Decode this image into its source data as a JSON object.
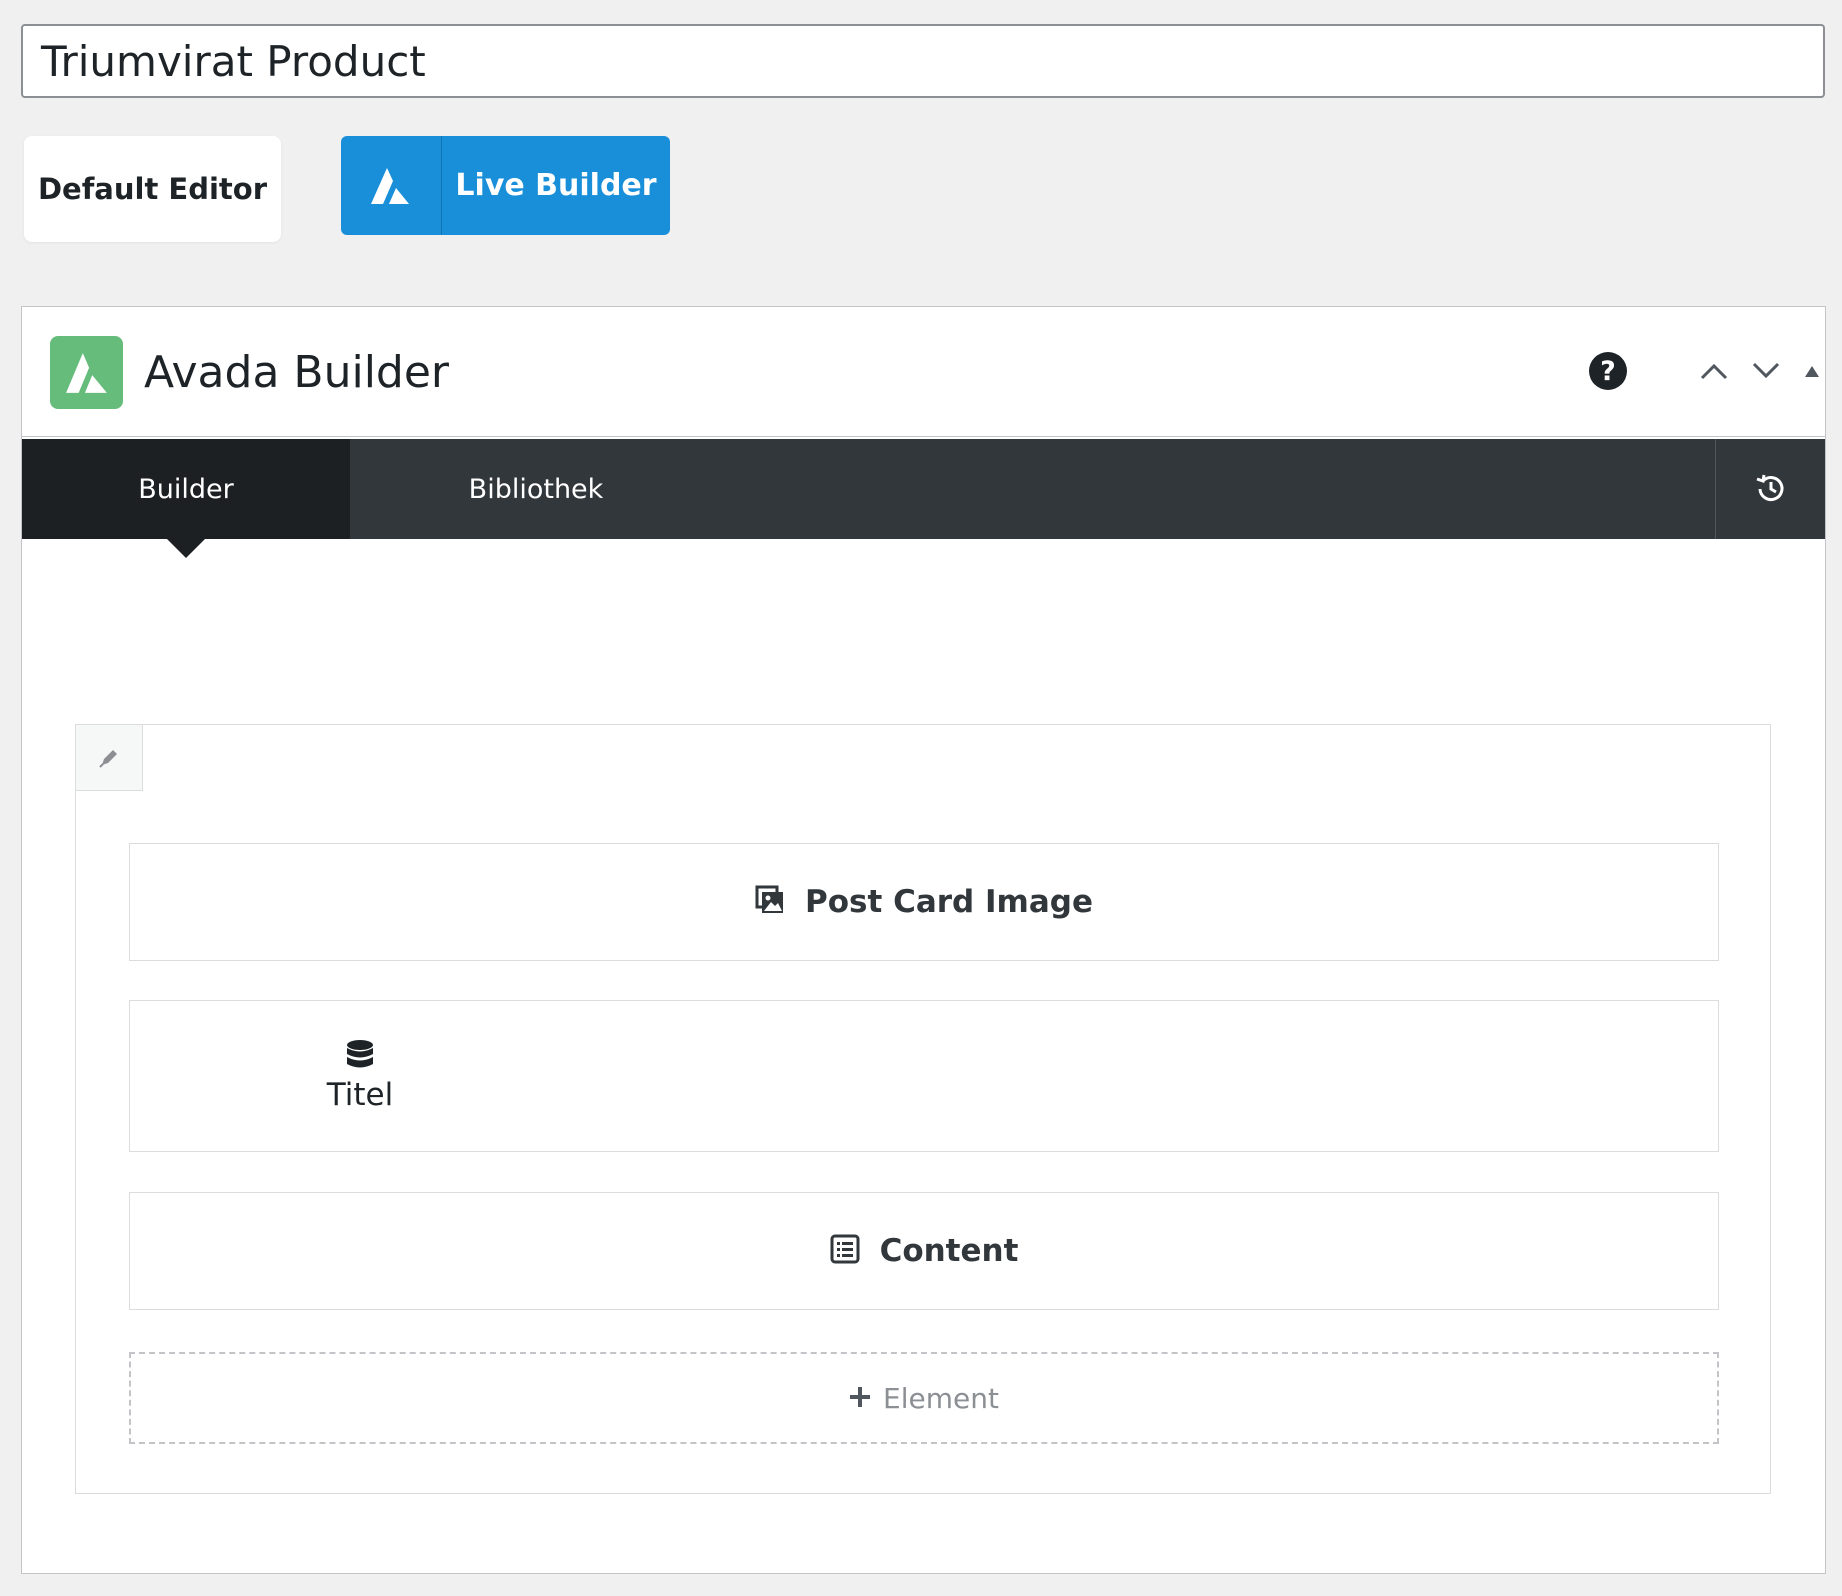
{
  "post": {
    "title_value": "Triumvirat Product"
  },
  "editor_switch": {
    "default_label": "Default Editor",
    "live_label": "Live Builder",
    "live_color": "#198fd9"
  },
  "panel": {
    "title": "Avada Builder",
    "brand_color": "#65bc7b",
    "icons": {
      "help": "help-icon",
      "move_up": "chevron-up-icon",
      "move_down": "chevron-down-icon",
      "toggle": "triangle-up-icon"
    },
    "help_glyph": "?"
  },
  "tabs": [
    {
      "label": "Builder",
      "active": true
    },
    {
      "label": "Bibliothek",
      "active": false
    }
  ],
  "history_icon": "history-icon",
  "container": {
    "edit_icon": "pencil-icon",
    "elements": [
      {
        "label": "Post Card Image",
        "icon": "gallery-icon"
      },
      {
        "label": "Titel",
        "icon": "database-icon"
      },
      {
        "label": "Content",
        "icon": "content-list-icon"
      }
    ],
    "add_element_label": "Element",
    "add_icon": "plus-icon"
  },
  "colors": {
    "tabbar_bg": "#32373c",
    "active_tab_bg": "#1d2022",
    "page_bg": "#f0f0f1"
  }
}
